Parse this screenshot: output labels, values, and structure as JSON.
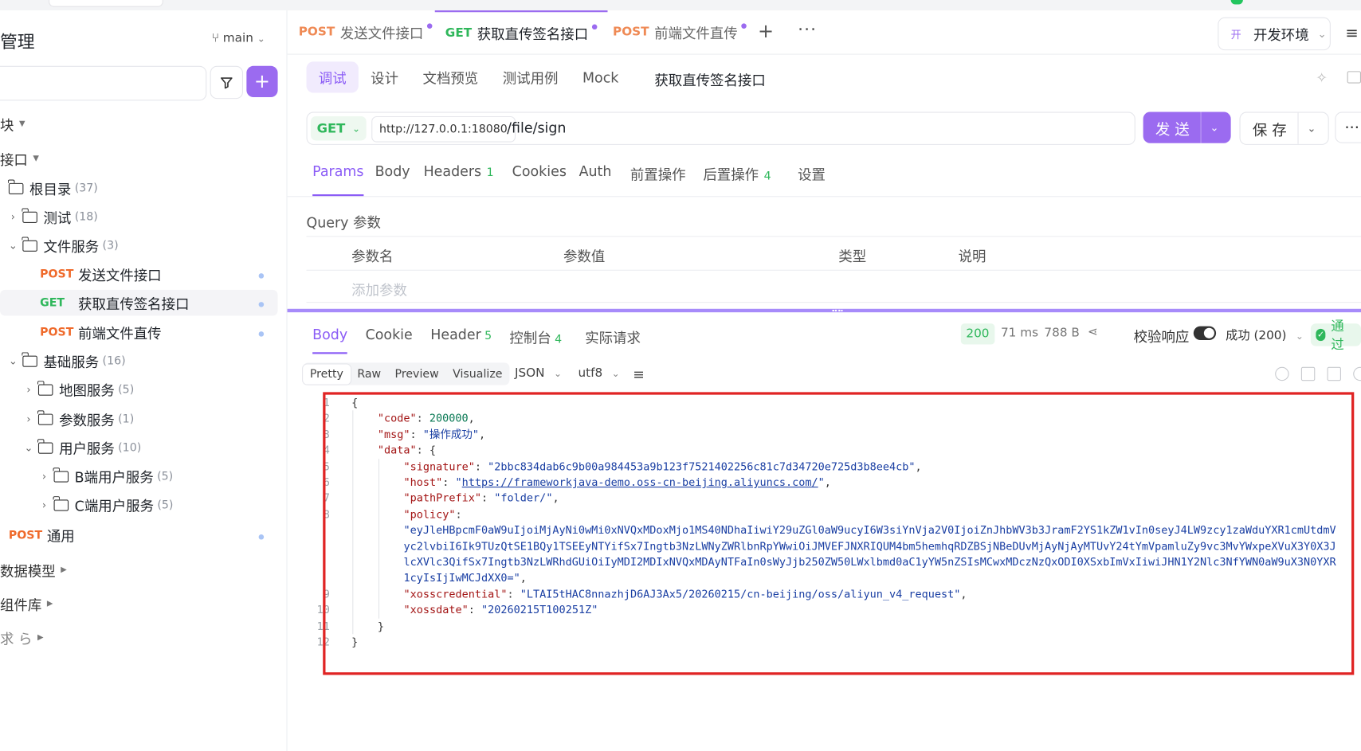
{
  "sidebar": {
    "title": "管理",
    "branch": "main",
    "sections": [
      {
        "label": "块"
      },
      {
        "label": "接口"
      }
    ],
    "tree": {
      "root": {
        "label": "根目录",
        "count": "(37)"
      },
      "test": {
        "label": "测试",
        "count": "(18)"
      },
      "file_service": {
        "label": "文件服务",
        "count": "(3)"
      },
      "apis": [
        {
          "method": "POST",
          "label": "发送文件接口"
        },
        {
          "method": "GET",
          "label": "获取直传签名接口"
        },
        {
          "method": "POST",
          "label": "前端文件直传"
        }
      ],
      "base_service": {
        "label": "基础服务",
        "count": "(16)"
      },
      "map_service": {
        "label": "地图服务",
        "count": "(5)"
      },
      "param_service": {
        "label": "参数服务",
        "count": "(1)"
      },
      "user_service": {
        "label": "用户服务",
        "count": "(10)"
      },
      "b_user_service": {
        "label": "B端用户服务",
        "count": "(5)"
      },
      "c_user_service": {
        "label": "C端用户服务",
        "count": "(5)"
      },
      "common": {
        "method": "POST",
        "label": "通用"
      }
    },
    "bottom_sections": [
      {
        "label": "数据模型"
      },
      {
        "label": "组件库"
      },
      {
        "label": "求 ら"
      }
    ]
  },
  "tabs": [
    {
      "method": "POST",
      "label": "发送文件接口"
    },
    {
      "method": "GET",
      "label": "获取直传签名接口"
    },
    {
      "method": "POST",
      "label": "前端文件直传"
    }
  ],
  "env": {
    "badge": "开",
    "label": "开发环境"
  },
  "subtabs": [
    "调试",
    "设计",
    "文档预览",
    "测试用例",
    "Mock"
  ],
  "api_name": "获取直传签名接口",
  "request": {
    "method": "GET",
    "base_url": "http://127.0.0.1:18080",
    "path": "/file/sign",
    "send_label": "发 送",
    "save_label": "保 存"
  },
  "req_tabs": {
    "params": "Params",
    "body": "Body",
    "headers": "Headers",
    "headers_count": "1",
    "cookies": "Cookies",
    "auth": "Auth",
    "pre": "前置操作",
    "post": "后置操作",
    "post_count": "4",
    "settings": "设置"
  },
  "query": {
    "label": "Query 参数",
    "columns": [
      "参数名",
      "参数值",
      "类型",
      "说明"
    ],
    "add_placeholder": "添加参数"
  },
  "response": {
    "tabs": {
      "body": "Body",
      "cookie": "Cookie",
      "header": "Header",
      "header_count": "5",
      "console": "控制台",
      "console_count": "4",
      "actual": "实际请求"
    },
    "status": "200",
    "time": "71 ms",
    "size": "788 B",
    "validate_label": "校验响应",
    "result_select": "成功 (200)",
    "pass_label": "通过",
    "formats": [
      "Pretty",
      "Raw",
      "Preview",
      "Visualize"
    ],
    "lang": "JSON",
    "encoding": "utf8",
    "json": {
      "code": "200000",
      "msg": "\"操作成功\"",
      "signature": "\"2bbc834dab6c9b00a984453a9b123f7521402256c81c7d34720e725d3b8ee4cb\"",
      "host": "https://frameworkjava-demo.oss-cn-beijing.aliyuncs.com/",
      "pathPrefix": "\"folder/\"",
      "policy_1": "\"eyJleHBpcmF0aW9uIjoiMjAyNi0wMi0xNVQxMDoxMjo1MS40NDhaIiwiY29uZGl0aW9ucyI6W3siYnVja2V0IjoiZnJhbWV3b3JramF2YS1kZW1vIn0seyJ4LW9zcy1zaWduYXR1cmUtdmV",
      "policy_2": "yc2lvbiI6Ik9TUzQtSE1BQy1TSEEyNTYifSx7Ingtb3NzLWNyZWRlbnRpYWwiOiJMVEFJNXRIQUM4bm5hemhqRDZBSjNBeDUvMjAyNjAyMTUvY24tYmVpamluZy9vc3MvYWxpeXVuX3Y0X3J",
      "policy_3": "lcXVlc3QifSx7Ingtb3NzLWRhdGUiOiIyMDI2MDIxNVQxMDAyNTFaIn0sWyJjb250ZW50LWxlbmd0aC1yYW5nZSIsMCwxMDczNzQxODI0XSxbImVxIiwiJHN1Y2Nlc3NfYWN0aW9uX3N0YXR",
      "policy_4": "1cyIsIjIwMCJdXX0=\"",
      "xosscredential": "\"LTAI5tHAC8nnazhjD6AJ3Ax5/20260215/cn-beijing/oss/aliyun_v4_request\"",
      "xossdate": "\"20260215T100251Z\""
    }
  }
}
